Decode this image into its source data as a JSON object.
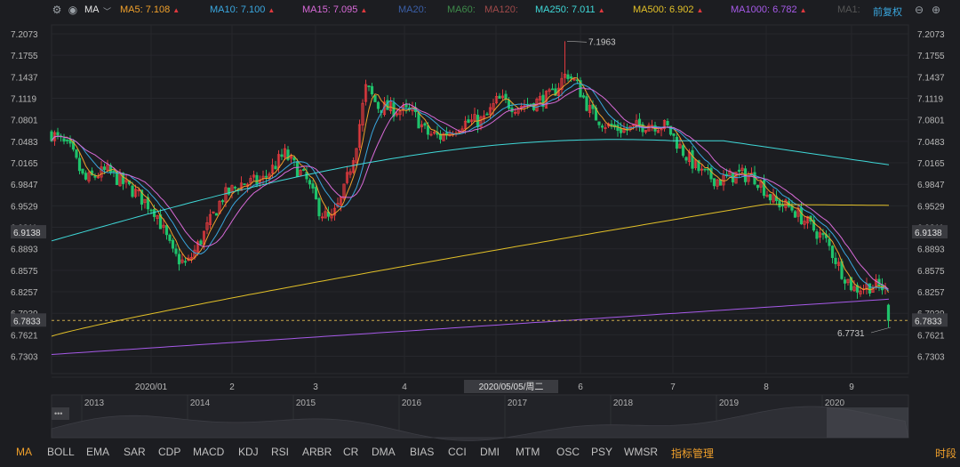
{
  "topbar": {
    "indicator_name": "MA",
    "ma_items": [
      {
        "label": "MA5: 7.108",
        "color": "#f0a02b",
        "arrow": "▲"
      },
      {
        "label": "MA10: 7.100",
        "color": "#3aa8e0",
        "arrow": "▲"
      },
      {
        "label": "MA15: 7.095",
        "color": "#d86ad8",
        "arrow": "▲"
      },
      {
        "label": "MA20:",
        "color": "#3b5fa8",
        "arrow": ""
      },
      {
        "label": "MA60:",
        "color": "#3e8a4a",
        "arrow": ""
      },
      {
        "label": "MA120:",
        "color": "#a04a4a",
        "arrow": ""
      },
      {
        "label": "MA250: 7.011",
        "color": "#3fd8d8",
        "arrow": "▲"
      },
      {
        "label": "MA500: 6.902",
        "color": "#e2c028",
        "arrow": "▲"
      },
      {
        "label": "MA1000: 6.782",
        "color": "#a65ae8",
        "arrow": "▲"
      },
      {
        "label": "MA1:",
        "color": "#555555",
        "arrow": ""
      }
    ],
    "adjust_label": "前复权"
  },
  "price_axis": {
    "ticks": [
      "7.2073",
      "7.1755",
      "7.1437",
      "7.1119",
      "7.0801",
      "7.0483",
      "7.0165",
      "6.9847",
      "6.9529",
      "6.9211",
      "6.8893",
      "6.8575",
      "6.8257",
      "6.7939",
      "6.7621",
      "6.7303"
    ],
    "highlight_upper": "6.9138",
    "highlight_current": "6.7833",
    "high_label": "7.1963",
    "low_label": "6.7731"
  },
  "time_axis": {
    "labels": [
      "2020/01",
      "2",
      "3",
      "4",
      "6",
      "7",
      "8",
      "9"
    ],
    "crosshair_label": "2020/05/05/周二"
  },
  "navigator": {
    "years": [
      "2013",
      "2014",
      "2015",
      "2016",
      "2017",
      "2018",
      "2019",
      "2020"
    ]
  },
  "bottom_tabs": {
    "items": [
      "MA",
      "BOLL",
      "EMA",
      "SAR",
      "CDP",
      "MACD",
      "KDJ",
      "RSI",
      "ARBR",
      "CR",
      "DMA",
      "BIAS",
      "CCI",
      "DMI",
      "MTM",
      "OSC",
      "PSY",
      "WMSR"
    ],
    "manage_label": "指标管理",
    "timeshare_label": "时段"
  },
  "colors": {
    "up": "#e0393e",
    "down": "#1fc26b",
    "ma5": "#f0a02b",
    "ma10": "#3aa8e0",
    "ma15": "#d86ad8",
    "ma250": "#3fd8d8",
    "ma500": "#e2c028",
    "ma1000": "#a65ae8",
    "accent": "#f0a02b"
  }
}
